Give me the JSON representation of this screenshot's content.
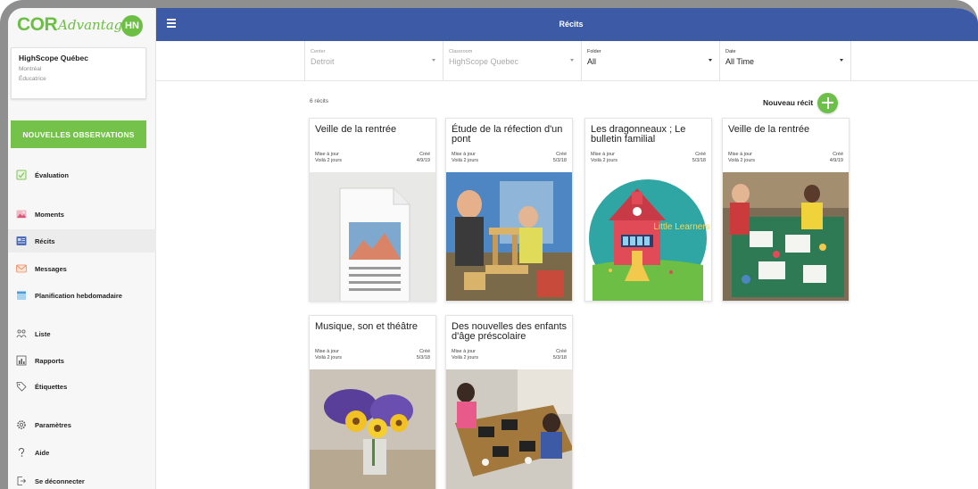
{
  "brand": {
    "cor": "COR",
    "advantage": "Advantage",
    "avatar_initials": "HN"
  },
  "user": {
    "name": "HighScope Québec",
    "city": "Montréal",
    "role": "Éducatrice"
  },
  "sidebar": {
    "new_observations": "NOUVELLES OBSERVATIONS",
    "items": [
      {
        "label": "Évaluation",
        "icon": "assessment-icon"
      },
      {
        "label": "Moments",
        "icon": "photo-icon"
      },
      {
        "label": "Récits",
        "icon": "story-icon"
      },
      {
        "label": "Messages",
        "icon": "mail-icon"
      },
      {
        "label": "Planification hebdomadaire",
        "icon": "calendar-icon"
      },
      {
        "label": "Liste",
        "icon": "people-icon"
      },
      {
        "label": "Rapports",
        "icon": "chart-icon"
      },
      {
        "label": "Étiquettes",
        "icon": "tag-icon"
      },
      {
        "label": "Paramètres",
        "icon": "gear-icon"
      },
      {
        "label": "Aide",
        "icon": "help-icon"
      },
      {
        "label": "Se déconnecter",
        "icon": "logout-icon"
      }
    ]
  },
  "header": {
    "title": "Récits"
  },
  "filters": {
    "center": {
      "label": "Center",
      "value": "Detroit"
    },
    "classroom": {
      "label": "Classroom",
      "value": "HighScope Quebec"
    },
    "folder": {
      "label": "Folder",
      "value": "All"
    },
    "date": {
      "label": "Date",
      "value": "All Time"
    }
  },
  "main": {
    "count": "6 récits",
    "new_story": "Nouveau récit",
    "updated_label": "Mise à jour",
    "updated_value": "Voilà 2 jours",
    "created_label": "Créé",
    "cards": [
      {
        "title": "Veille de la rentrée",
        "created": "4/9/19",
        "thumb": "document-placeholder"
      },
      {
        "title": "Étude de la réfection d'un pont",
        "created": "5/3/18",
        "thumb": "photo-blocks"
      },
      {
        "title": "Les dragonneaux ; Le bulletin familial",
        "created": "5/3/18",
        "thumb": "little-learners-logo",
        "thumb_text": "Little Learners"
      },
      {
        "title": "Veille de la rentrée",
        "created": "4/9/19",
        "thumb": "photo-classroom"
      },
      {
        "title": "Musique, son et théâtre",
        "created": "5/3/18",
        "thumb": "photo-flowers"
      },
      {
        "title": "Des nouvelles des enfants d'âge préscolaire",
        "created": "5/3/18",
        "thumb": "photo-art-table"
      }
    ]
  },
  "colors": {
    "topbar": "#3c5aa5",
    "brand_green": "#6cbf44",
    "frame": "#8f8f8f"
  }
}
